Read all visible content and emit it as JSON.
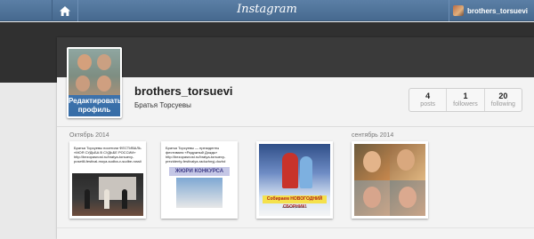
{
  "nav": {
    "logo": "Instagram",
    "home_icon": "home-icon",
    "username": "brothers_torsuevi"
  },
  "profile": {
    "username": "brothers_torsuevi",
    "full_name": "Братья Торсуевы",
    "edit_button": "Редактировать профиль"
  },
  "stats": [
    {
      "value": "4",
      "label": "posts"
    },
    {
      "value": "1",
      "label": "followers"
    },
    {
      "value": "20",
      "label": "following"
    }
  ],
  "months": [
    "Октябрь 2014",
    "сентябрь 2014"
  ],
  "posts": [
    {
      "text": "Братья Торсуевы посетили ФЕСТИВАЛЬ «МОЯ СУДЬБА В СУДЬБЕ РОССИИ» http://bezopasnost.ru/bratya-torsuevy-posetili-festival-moya-sudba-v-sudbe-rossii"
    },
    {
      "text": "Братья Торсуевы — президенты фестиваля «Радужный Дождь» http://bezopasnost.ru/bratya-torsuevy-prezidenty-festivalya-raduzhnyj-dozhd",
      "banner": "ЖЮРИ КОНКУРСА"
    },
    {
      "title": "Собираем НОВОГОДНИЙ СБОРНИК!",
      "url": "www.bezopasnost.ru"
    },
    {}
  ]
}
